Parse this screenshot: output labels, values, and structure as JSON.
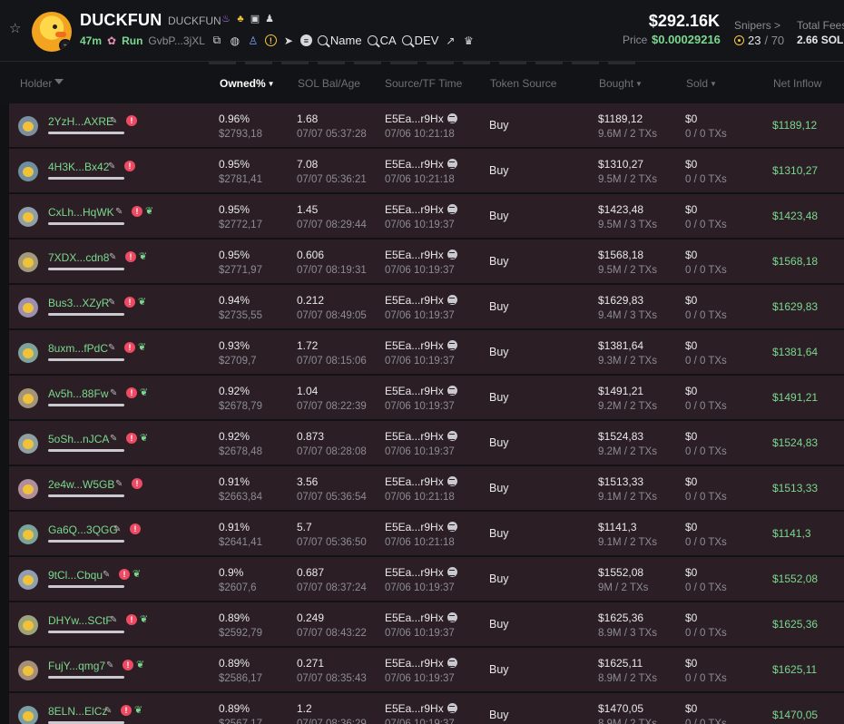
{
  "header": {
    "token_name": "DUCKFUN",
    "token_sub": "DUCKFUN",
    "age": "47m",
    "launchpad": "Run",
    "contract_short": "GvbP...3jXL",
    "chips": [
      "Name",
      "CA",
      "DEV"
    ],
    "market_cap": "$292.16K",
    "price_label": "Price",
    "price_value": "$0.00029216",
    "snipers_label": "Snipers >",
    "snipers_count": "23",
    "snipers_total": "/ 70",
    "fees_label": "Total Fees",
    "fees_value": "2.66 SOL"
  },
  "table": {
    "columns": {
      "holder": "Holder",
      "owned": "Owned%",
      "sol": "SOL Bal/Age",
      "source": "Source/TF Time",
      "token_source": "Token Source",
      "bought": "Bought",
      "sold": "Sold",
      "net": "Net Inflow"
    },
    "rows": [
      {
        "addr": "2YzH...AXRE",
        "leaf": false,
        "pct": "0.96%",
        "usd": "$2793,18",
        "sol": "1.68",
        "age": "07/07 05:37:28",
        "src": "E5Ea...r9Hx",
        "tf": "07/06 10:21:18",
        "token_source": "Buy",
        "bought": "$1189,12",
        "bought_sub": "9.6M / 2 TXs",
        "sold": "$0",
        "sold_sub": "0 / 0 TXs",
        "net": "$1189,12"
      },
      {
        "addr": "4H3K...Bx42",
        "leaf": false,
        "pct": "0.95%",
        "usd": "$2781,41",
        "sol": "7.08",
        "age": "07/07 05:36:21",
        "src": "E5Ea...r9Hx",
        "tf": "07/06 10:21:18",
        "token_source": "Buy",
        "bought": "$1310,27",
        "bought_sub": "9.5M / 2 TXs",
        "sold": "$0",
        "sold_sub": "0 / 0 TXs",
        "net": "$1310,27"
      },
      {
        "addr": "CxLh...HqWK",
        "leaf": true,
        "pct": "0.95%",
        "usd": "$2772,17",
        "sol": "1.45",
        "age": "07/07 08:29:44",
        "src": "E5Ea...r9Hx",
        "tf": "07/06 10:19:37",
        "token_source": "Buy",
        "bought": "$1423,48",
        "bought_sub": "9.5M / 3 TXs",
        "sold": "$0",
        "sold_sub": "0 / 0 TXs",
        "net": "$1423,48"
      },
      {
        "addr": "7XDX...cdn8",
        "leaf": true,
        "pct": "0.95%",
        "usd": "$2771,97",
        "sol": "0.606",
        "age": "07/07 08:19:31",
        "src": "E5Ea...r9Hx",
        "tf": "07/06 10:19:37",
        "token_source": "Buy",
        "bought": "$1568,18",
        "bought_sub": "9.5M / 2 TXs",
        "sold": "$0",
        "sold_sub": "0 / 0 TXs",
        "net": "$1568,18"
      },
      {
        "addr": "Bus3...XZyR",
        "leaf": true,
        "pct": "0.94%",
        "usd": "$2735,55",
        "sol": "0.212",
        "age": "07/07 08:49:05",
        "src": "E5Ea...r9Hx",
        "tf": "07/06 10:19:37",
        "token_source": "Buy",
        "bought": "$1629,83",
        "bought_sub": "9.4M / 3 TXs",
        "sold": "$0",
        "sold_sub": "0 / 0 TXs",
        "net": "$1629,83"
      },
      {
        "addr": "8uxm...fPdC",
        "leaf": true,
        "pct": "0.93%",
        "usd": "$2709,7",
        "sol": "1.72",
        "age": "07/07 08:15:06",
        "src": "E5Ea...r9Hx",
        "tf": "07/06 10:19:37",
        "token_source": "Buy",
        "bought": "$1381,64",
        "bought_sub": "9.3M / 2 TXs",
        "sold": "$0",
        "sold_sub": "0 / 0 TXs",
        "net": "$1381,64"
      },
      {
        "addr": "Av5h...88Fw",
        "leaf": true,
        "pct": "0.92%",
        "usd": "$2678,79",
        "sol": "1.04",
        "age": "07/07 08:22:39",
        "src": "E5Ea...r9Hx",
        "tf": "07/06 10:19:37",
        "token_source": "Buy",
        "bought": "$1491,21",
        "bought_sub": "9.2M / 2 TXs",
        "sold": "$0",
        "sold_sub": "0 / 0 TXs",
        "net": "$1491,21"
      },
      {
        "addr": "5oSh...nJCA",
        "leaf": true,
        "pct": "0.92%",
        "usd": "$2678,48",
        "sol": "0.873",
        "age": "07/07 08:28:08",
        "src": "E5Ea...r9Hx",
        "tf": "07/06 10:19:37",
        "token_source": "Buy",
        "bought": "$1524,83",
        "bought_sub": "9.2M / 2 TXs",
        "sold": "$0",
        "sold_sub": "0 / 0 TXs",
        "net": "$1524,83"
      },
      {
        "addr": "2e4w...W5GB",
        "leaf": false,
        "pct": "0.91%",
        "usd": "$2663,84",
        "sol": "3.56",
        "age": "07/07 05:36:54",
        "src": "E5Ea...r9Hx",
        "tf": "07/06 10:21:18",
        "token_source": "Buy",
        "bought": "$1513,33",
        "bought_sub": "9.1M / 2 TXs",
        "sold": "$0",
        "sold_sub": "0 / 0 TXs",
        "net": "$1513,33"
      },
      {
        "addr": "Ga6Q...3QGG",
        "leaf": false,
        "pct": "0.91%",
        "usd": "$2641,41",
        "sol": "5.7",
        "age": "07/07 05:36:50",
        "src": "E5Ea...r9Hx",
        "tf": "07/06 10:21:18",
        "token_source": "Buy",
        "bought": "$1141,3",
        "bought_sub": "9.1M / 2 TXs",
        "sold": "$0",
        "sold_sub": "0 / 0 TXs",
        "net": "$1141,3"
      },
      {
        "addr": "9tCl...Cbqu",
        "leaf": true,
        "pct": "0.9%",
        "usd": "$2607,6",
        "sol": "0.687",
        "age": "07/07 08:37:24",
        "src": "E5Ea...r9Hx",
        "tf": "07/06 10:19:37",
        "token_source": "Buy",
        "bought": "$1552,08",
        "bought_sub": "9M / 2 TXs",
        "sold": "$0",
        "sold_sub": "0 / 0 TXs",
        "net": "$1552,08"
      },
      {
        "addr": "DHYw...SCtF",
        "leaf": true,
        "pct": "0.89%",
        "usd": "$2592,79",
        "sol": "0.249",
        "age": "07/07 08:43:22",
        "src": "E5Ea...r9Hx",
        "tf": "07/06 10:19:37",
        "token_source": "Buy",
        "bought": "$1625,36",
        "bought_sub": "8.9M / 3 TXs",
        "sold": "$0",
        "sold_sub": "0 / 0 TXs",
        "net": "$1625,36"
      },
      {
        "addr": "FujY...qmg7",
        "leaf": true,
        "pct": "0.89%",
        "usd": "$2586,17",
        "sol": "0.271",
        "age": "07/07 08:35:43",
        "src": "E5Ea...r9Hx",
        "tf": "07/06 10:19:37",
        "token_source": "Buy",
        "bought": "$1625,11",
        "bought_sub": "8.9M / 2 TXs",
        "sold": "$0",
        "sold_sub": "0 / 0 TXs",
        "net": "$1625,11"
      },
      {
        "addr": "8ELN...ElCz",
        "leaf": true,
        "pct": "0.89%",
        "usd": "$2567,17",
        "sol": "1.2",
        "age": "07/07 08:36:29",
        "src": "E5Ea...r9Hx",
        "tf": "07/06 10:19:37",
        "token_source": "Buy",
        "bought": "$1470,05",
        "bought_sub": "8.9M / 2 TXs",
        "sold": "$0",
        "sold_sub": "0 / 0 TXs",
        "net": "$1470,05"
      }
    ]
  },
  "colors": {
    "accent_green": "#7bd88f",
    "row_bg": "#2b1f25",
    "alert_red": "#ef4a63",
    "warn_yellow": "#f5c542"
  },
  "icons": [
    "star-icon",
    "globe-icon",
    "user-icon",
    "warning-icon",
    "telegram-icon",
    "coin-icon",
    "search-icon",
    "external-link-icon",
    "crown-icon",
    "filter-icon",
    "pencil-icon",
    "alert-icon",
    "leaf-icon",
    "target-icon"
  ]
}
